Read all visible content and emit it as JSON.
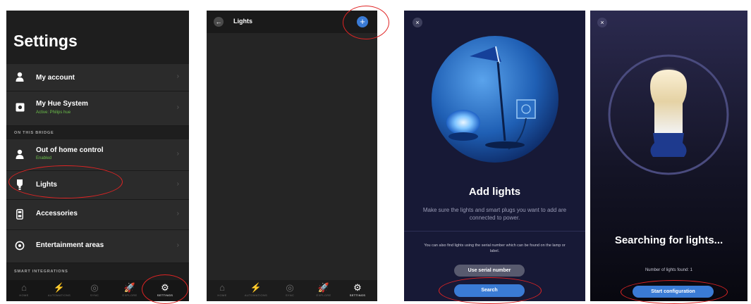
{
  "settings_screen": {
    "title": "Settings",
    "rows": [
      {
        "label": "My account"
      },
      {
        "label": "My Hue System",
        "sub": "Active: Philips hue"
      },
      {
        "label": "Out of home control",
        "sub": "Enabled"
      },
      {
        "label": "Lights"
      },
      {
        "label": "Accessories"
      },
      {
        "label": "Entertainment areas"
      }
    ],
    "sections": {
      "bridge": "ON THIS BRIDGE",
      "integrations": "SMART INTEGRATIONS"
    },
    "chevron": "›"
  },
  "nav": [
    {
      "icon": "⌂",
      "icon_name": "home-icon",
      "label": "HOME"
    },
    {
      "icon": "⚡",
      "icon_name": "automations-icon",
      "label": "AUTOMATIONS"
    },
    {
      "icon": "◎",
      "icon_name": "sync-icon",
      "label": "SYNC"
    },
    {
      "icon": "🚀",
      "icon_name": "explore-icon",
      "label": "EXPLORE"
    },
    {
      "icon": "⚙",
      "icon_name": "settings-icon",
      "label": "SETTINGS"
    }
  ],
  "lights_screen": {
    "title": "Lights",
    "back_icon": "←",
    "add_icon": "+"
  },
  "add_lights_screen": {
    "close_icon": "×",
    "title": "Add lights",
    "description": "Make sure the lights and smart plugs you want to add are connected to power.",
    "note": "You can also find lights using the serial number which can be found on the lamp or label.",
    "serial_button": "Use serial number",
    "search_button": "Search"
  },
  "searching_screen": {
    "close_icon": "×",
    "title": "Searching for lights...",
    "found_text": "Number of lights found: 1",
    "config_button": "Start configuration"
  },
  "colors": {
    "accent": "#3a7bd5",
    "highlight": "#e02424",
    "status_green": "#6cc04a"
  }
}
